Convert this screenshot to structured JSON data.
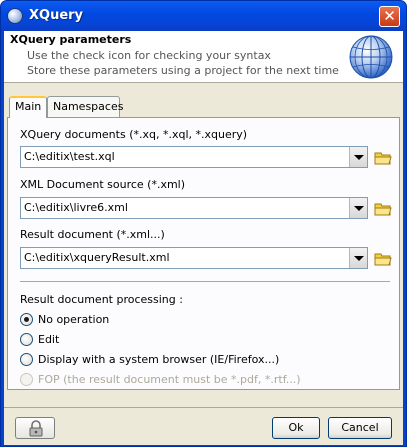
{
  "window": {
    "title": "XQuery",
    "close_glyph": "✕",
    "icon": "globe-icon"
  },
  "header": {
    "title": "XQuery parameters",
    "desc_line1": "Use the check icon for checking your syntax",
    "desc_line2": "Store these parameters using a project for the next time",
    "icon": "globe-icon"
  },
  "tabs": [
    {
      "label": "Main",
      "active": true
    },
    {
      "label": "Namespaces",
      "active": false
    }
  ],
  "fields": {
    "xquery_documents": {
      "label": "XQuery documents (*.xq, *.xql, *.xquery)",
      "value": "C:\\editix\\test.xql"
    },
    "xml_source": {
      "label": "XML Document source (*.xml)",
      "value": "C:\\editix\\livre6.xml"
    },
    "result_document": {
      "label": "Result document (*.xml...)",
      "value": "C:\\editix\\xqueryResult.xml"
    }
  },
  "processing": {
    "label": "Result document processing :",
    "options": [
      {
        "label": "No operation",
        "checked": true,
        "disabled": false
      },
      {
        "label": "Edit",
        "checked": false,
        "disabled": false
      },
      {
        "label": "Display with a system browser (IE/Firefox...)",
        "checked": false,
        "disabled": false
      },
      {
        "label": "FOP (the result document must be *.pdf, *.rtf...)",
        "checked": false,
        "disabled": true
      }
    ]
  },
  "buttons": {
    "ok": "Ok",
    "cancel": "Cancel",
    "lock_icon": "lock-icon"
  },
  "colors": {
    "titlebar": "#0054e3",
    "dialog_bg": "#ece9d8",
    "folder": "#f4d03f"
  }
}
